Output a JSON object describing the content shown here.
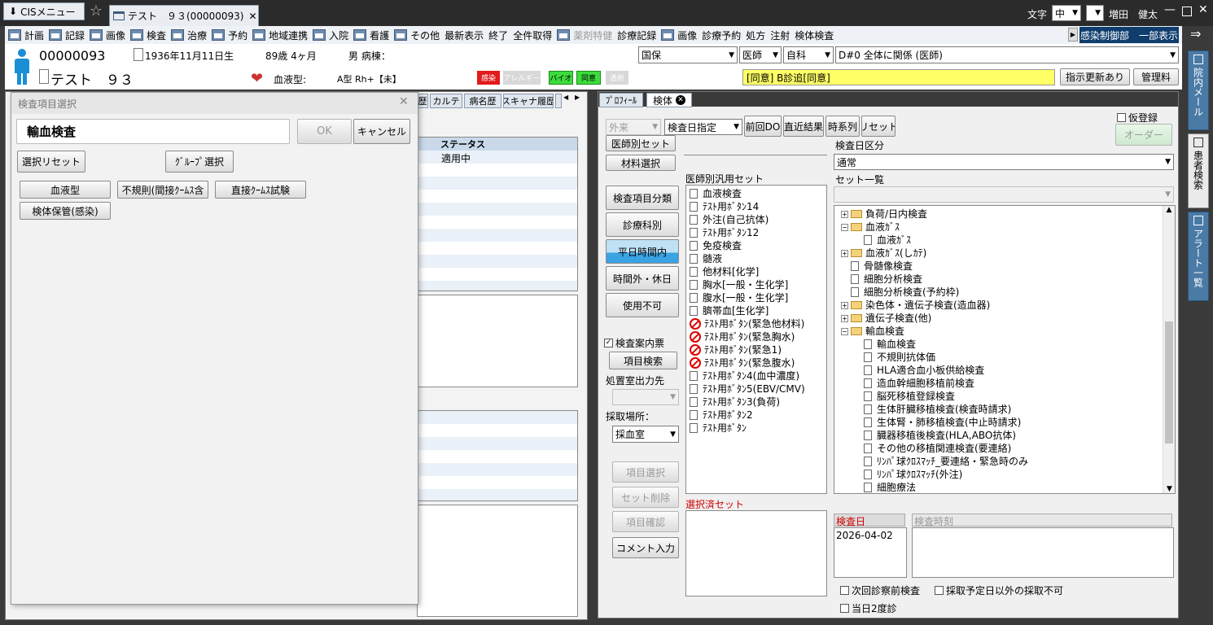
{
  "app": {
    "menu_label": "CISメニュー",
    "patient_tab": "テスト　９３(00000093)",
    "font_label": "文字",
    "font_size": "中",
    "user": "増田　健太"
  },
  "toolbar": {
    "items": [
      "計画",
      "記録",
      "画像",
      "検査",
      "治療",
      "予約",
      "地域連携",
      "入院",
      "看護",
      "その他",
      "最新表示",
      "終了",
      "全件取得",
      "薬剤特健",
      "診療記録",
      "画像",
      "診療予約",
      "処方",
      "注射",
      "検体検査"
    ],
    "right_label": "感染制御部　一部表示"
  },
  "patient": {
    "id": "00000093",
    "dob": "1936年11月11日生",
    "age": "89歳 4ヶ月",
    "sex_ward": "男 病棟：",
    "name": "テスト　９３",
    "blood_label": "血液型:",
    "blood_value": "A型 Rh+【未】",
    "badges": [
      "感染",
      "アレルギー",
      "バイオ",
      "同意",
      "透析"
    ],
    "insurance": "国保",
    "doctor_type": "医師",
    "dept": "自科",
    "dx": "D#0  全体に関係 (医師)",
    "notice": "[同意] B診追[同意]",
    "update_btn": "指示更新あり",
    "mgmt_btn": "管理料"
  },
  "side": {
    "items": [
      "院内メール",
      "患者検索",
      "アラート一覧"
    ]
  },
  "left_tabs": [
    "歴",
    "カルテ",
    "病名歴",
    "スキャナ履歴"
  ],
  "left_table": {
    "header": "ステータス",
    "value": "適用中"
  },
  "dialog": {
    "title": "検査項目選択",
    "heading": "輸血検査",
    "ok": "OK",
    "cancel": "キャンセル",
    "reset": "選択リセット",
    "group": "ｸﾞﾙｰﾌﾟ選択",
    "buttons": [
      "血液型",
      "不規則(間接ｸｰﾑｽ含",
      "直接ｸｰﾑｽ試験",
      "検体保管(感染)"
    ]
  },
  "right": {
    "tabs": [
      "ﾌﾟﾛﾌｨｰﾙ",
      "検体"
    ],
    "visit": "外来",
    "date_mode": "検査日指定",
    "top_btns": [
      "前回DO",
      "直近結果",
      "時系列",
      "リセット"
    ],
    "kari": "仮登録",
    "order": "オーダー",
    "doctor_set": "医師別セット",
    "material": "材料選択",
    "cat_btns": [
      "検査項目分類",
      "診療科別",
      "平日時間内",
      "時間外・休日",
      "使用不可"
    ],
    "guide_label": "検査案内票",
    "item_search": "項目検索",
    "room_label": "処置室出力先",
    "place_label": "採取場所：",
    "place_value": "採血室",
    "action_btns": [
      "項目選択",
      "セット削除",
      "項目確認",
      "コメント入力"
    ],
    "common_set_label": "医師別汎用セット",
    "common_sets": [
      {
        "t": "血液検査",
        "i": "doc"
      },
      {
        "t": "ﾃｽﾄ用ﾎﾞﾀﾝ14",
        "i": "doc"
      },
      {
        "t": "外注(自己抗体)",
        "i": "doc"
      },
      {
        "t": "ﾃｽﾄ用ﾎﾞﾀﾝ12",
        "i": "doc"
      },
      {
        "t": "免疫検査",
        "i": "doc"
      },
      {
        "t": "髄液",
        "i": "doc"
      },
      {
        "t": "他材料[化学]",
        "i": "doc"
      },
      {
        "t": "胸水[一般・生化学]",
        "i": "doc"
      },
      {
        "t": "腹水[一般・生化学]",
        "i": "doc"
      },
      {
        "t": "臍帯血[生化学]",
        "i": "doc"
      },
      {
        "t": "ﾃｽﾄ用ﾎﾞﾀﾝ(緊急他材料)",
        "i": "no"
      },
      {
        "t": "ﾃｽﾄ用ﾎﾞﾀﾝ(緊急胸水)",
        "i": "no"
      },
      {
        "t": "ﾃｽﾄ用ﾎﾞﾀﾝ(緊急1)",
        "i": "no"
      },
      {
        "t": "ﾃｽﾄ用ﾎﾞﾀﾝ(緊急腹水)",
        "i": "no"
      },
      {
        "t": "ﾃｽﾄ用ﾎﾞﾀﾝ4(血中濃度)",
        "i": "doc"
      },
      {
        "t": "ﾃｽﾄ用ﾎﾞﾀﾝ5(EBV/CMV)",
        "i": "doc"
      },
      {
        "t": "ﾃｽﾄ用ﾎﾞﾀﾝ3(負荷)",
        "i": "doc"
      },
      {
        "t": "ﾃｽﾄ用ﾎﾞﾀﾝ2",
        "i": "doc"
      },
      {
        "t": "ﾃｽﾄ用ﾎﾞﾀﾝ",
        "i": "doc"
      }
    ],
    "selected_set_label": "選択済セット",
    "day_type_label": "検査日区分",
    "day_type": "通常",
    "set_list_label": "セット一覧",
    "tree": [
      {
        "t": "負荷/日内検査",
        "lv": 0,
        "k": "fc"
      },
      {
        "t": "血液ｶﾞｽ",
        "lv": 0,
        "k": "fo"
      },
      {
        "t": "血液ｶﾞｽ",
        "lv": 1,
        "k": "doc"
      },
      {
        "t": "血液ｶﾞｽ(しｶﾃ)",
        "lv": 0,
        "k": "fc"
      },
      {
        "t": "骨髄像検査",
        "lv": 0,
        "k": "doc"
      },
      {
        "t": "細胞分析検査",
        "lv": 0,
        "k": "doc"
      },
      {
        "t": "細胞分析検査(予約枠)",
        "lv": 0,
        "k": "doc"
      },
      {
        "t": "染色体・遺伝子検査(造血器)",
        "lv": 0,
        "k": "fc"
      },
      {
        "t": "遺伝子検査(他)",
        "lv": 0,
        "k": "fc"
      },
      {
        "t": "輸血検査",
        "lv": 0,
        "k": "fo"
      },
      {
        "t": "輸血検査",
        "lv": 1,
        "k": "doc"
      },
      {
        "t": "不規則抗体価",
        "lv": 1,
        "k": "doc"
      },
      {
        "t": "HLA適合血小板供給検査",
        "lv": 1,
        "k": "doc"
      },
      {
        "t": "造血幹細胞移植前検査",
        "lv": 1,
        "k": "doc"
      },
      {
        "t": "脳死移植登録検査",
        "lv": 1,
        "k": "doc"
      },
      {
        "t": "生体肝臓移植検査(検査時請求)",
        "lv": 1,
        "k": "doc"
      },
      {
        "t": "生体腎・肺移植検査(中止時請求)",
        "lv": 1,
        "k": "doc"
      },
      {
        "t": "臓器移植後検査(HLA,ABO抗体)",
        "lv": 1,
        "k": "doc"
      },
      {
        "t": "その他の移植関連検査(要連絡)",
        "lv": 1,
        "k": "doc"
      },
      {
        "t": "ﾘﾝﾊﾟ球ｸﾛｽﾏｯﾁ_要連絡・緊急時のみ",
        "lv": 1,
        "k": "doc"
      },
      {
        "t": "ﾘﾝﾊﾟ球ｸﾛｽﾏｯﾁ(外注)",
        "lv": 1,
        "k": "doc"
      },
      {
        "t": "細胞療法",
        "lv": 1,
        "k": "doc"
      }
    ],
    "date_header": "検査日",
    "time_header": "検査時刻",
    "date_value": "2026-04-02",
    "chk1": "次回診察前検査",
    "chk2": "採取予定日以外の採取不可",
    "chk3": "当日2度診"
  }
}
